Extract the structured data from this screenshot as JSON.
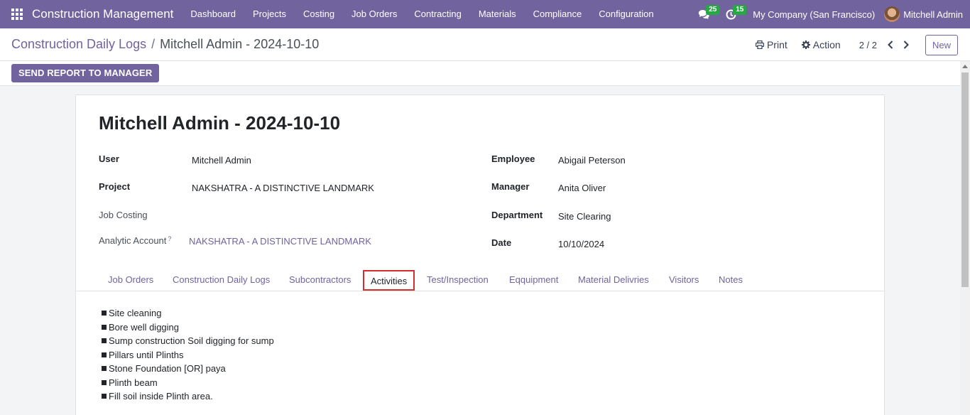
{
  "nav": {
    "brand": "Construction Management",
    "menu": [
      "Dashboard",
      "Projects",
      "Costing",
      "Job Orders",
      "Contracting",
      "Materials",
      "Compliance",
      "Configuration"
    ],
    "messages_count": "25",
    "activities_count": "15",
    "company": "My Company (San Francisco)",
    "user": "Mitchell Admin"
  },
  "control": {
    "breadcrumb_parent": "Construction Daily Logs",
    "breadcrumb_separator": "/",
    "breadcrumb_current": "Mitchell Admin - 2024-10-10",
    "print_label": "Print",
    "action_label": "Action",
    "pager": "2 / 2",
    "new_label": "New"
  },
  "status": {
    "send_report_label": "SEND REPORT TO MANAGER"
  },
  "record": {
    "title": "Mitchell Admin - 2024-10-10",
    "fields_left": [
      {
        "label": "User",
        "value": "Mitchell Admin"
      },
      {
        "label": "Project",
        "value": "NAKSHATRA - A DISTINCTIVE LANDMARK"
      },
      {
        "label": "Job Costing",
        "value": ""
      },
      {
        "label": "Analytic Account",
        "help": "?",
        "value": "NAKSHATRA - A DISTINCTIVE LANDMARK"
      }
    ],
    "fields_right": [
      {
        "label": "Employee",
        "value": "Abigail Peterson"
      },
      {
        "label": "Manager",
        "value": "Anita Oliver"
      },
      {
        "label": "Department",
        "value": "Site Clearing"
      },
      {
        "label": "Date",
        "value": "10/10/2024"
      }
    ]
  },
  "tabs": [
    "Job Orders",
    "Construction Daily Logs",
    "Subcontractors",
    "Activities",
    "Test/Inspection",
    "Eqquipment",
    "Material Delivries",
    "Visitors",
    "Notes"
  ],
  "active_tab": "Activities",
  "activities": [
    "Site cleaning",
    "Bore well digging",
    "Sump construction Soil digging for sump",
    "Pillars until Plinths",
    "Stone Foundation [OR] paya",
    "Plinth beam",
    "Fill soil inside Plinth area."
  ],
  "colors": {
    "brand": "#71639e",
    "badge": "#28a745",
    "highlight": "#d32f2f"
  }
}
